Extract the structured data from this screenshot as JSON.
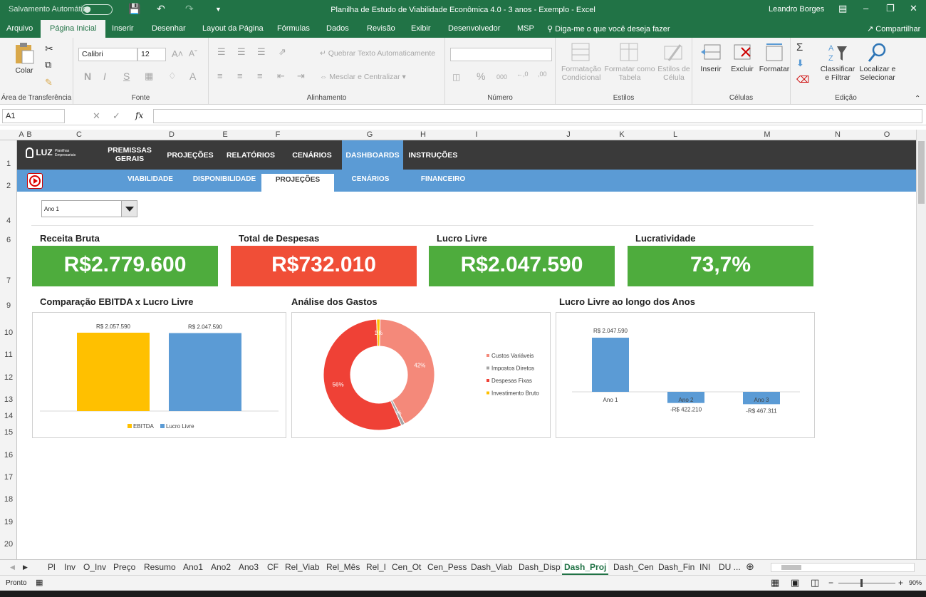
{
  "window": {
    "autosave_label": "Salvamento Automático",
    "title": "Planilha de Estudo de Viabilidade Econômica 4.0 - 3 anos - Exemplo  -  Excel",
    "user": "Leandro Borges"
  },
  "ribbon_tabs": [
    "Arquivo",
    "Página Inicial",
    "Inserir",
    "Desenhar",
    "Layout da Página",
    "Fórmulas",
    "Dados",
    "Revisão",
    "Exibir",
    "Desenvolvedor",
    "MSP"
  ],
  "tell_me": "Diga-me o que você deseja fazer",
  "share": "Compartilhar",
  "ribbon": {
    "paste": "Colar",
    "clipboard": "Área de Transferência",
    "font_name": "Calibri",
    "font_size": "12",
    "font_group": "Fonte",
    "wrap_text": "Quebrar Texto Automaticamente",
    "merge_center": "Mesclar e Centralizar",
    "alignment_group": "Alinhamento",
    "number_group": "Número",
    "cond_format_1": "Formatação",
    "cond_format_2": "Condicional",
    "format_table_1": "Formatar como",
    "format_table_2": "Tabela",
    "cell_styles_1": "Estilos de",
    "cell_styles_2": "Célula",
    "styles_group": "Estilos",
    "insert": "Inserir",
    "delete": "Excluir",
    "format": "Formatar",
    "cells_group": "Células",
    "sort_1": "Classificar",
    "sort_2": "e Filtrar",
    "find_1": "Localizar e",
    "find_2": "Selecionar",
    "editing_group": "Edição"
  },
  "formula_bar": {
    "name_box": "A1",
    "fx": "fx"
  },
  "columns": [
    "A",
    "B",
    "C",
    "D",
    "E",
    "F",
    "G",
    "H",
    "I",
    "J",
    "K",
    "L",
    "M",
    "N",
    "O"
  ],
  "rows": [
    "1",
    "2",
    "4",
    "6",
    "7",
    "9",
    "10",
    "11",
    "12",
    "13",
    "14",
    "15",
    "16",
    "17",
    "18",
    "19",
    "20"
  ],
  "dashboard": {
    "logo": "LUZ",
    "logo_sub": "Planilhas Empresariais",
    "nav": [
      "PREMISSAS GERAIS",
      "PROJEÇÕES",
      "RELATÓRIOS",
      "CENÁRIOS",
      "DASHBOARDS",
      "INSTRUÇÕES"
    ],
    "subnav": [
      "VIABILIDADE",
      "DISPONIBILIDADE",
      "PROJEÇÕES",
      "CENÁRIOS",
      "FINANCEIRO"
    ],
    "year_select": "Ano 1",
    "kpis": [
      {
        "title": "Receita Bruta",
        "value": "R$2.779.600",
        "color": "#4eac3d"
      },
      {
        "title": "Total de Despesas",
        "value": "R$732.010",
        "color": "#f04e37"
      },
      {
        "title": "Lucro Livre",
        "value": "R$2.047.590",
        "color": "#4eac3d"
      },
      {
        "title": "Lucratividade",
        "value": "73,7%",
        "color": "#4eac3d"
      }
    ],
    "charts_titles": [
      "Comparação EBITDA x Lucro Livre",
      "Análise dos Gastos",
      "Lucro Livre ao longo dos Anos"
    ]
  },
  "chart_data": [
    {
      "type": "bar",
      "title": "Comparação EBITDA x Lucro Livre",
      "series": [
        {
          "name": "EBITDA",
          "values": [
            2057590
          ],
          "label": "R$ 2.057.590",
          "color": "#ffc000"
        },
        {
          "name": "Lucro Livre",
          "values": [
            2047590
          ],
          "label": "R$ 2.047.590",
          "color": "#5b9bd5"
        }
      ],
      "legend": "bottom"
    },
    {
      "type": "pie",
      "title": "Análise dos Gastos",
      "donut": true,
      "slices": [
        {
          "name": "Custos Variáveis",
          "value": 42,
          "label": "42%",
          "color": "#f4897a"
        },
        {
          "name": "Impostos Diretos",
          "value": 1,
          "label": "1%",
          "color": "#a5a5a5"
        },
        {
          "name": "Despesas Fixas",
          "value": 56,
          "label": "56%",
          "color": "#ef4136"
        },
        {
          "name": "Investimento Bruto",
          "value": 1,
          "label": "1%",
          "color": "#ffc000"
        }
      ],
      "legend": "right"
    },
    {
      "type": "bar",
      "title": "Lucro Livre ao longo dos Anos",
      "categories": [
        "Ano 1",
        "Ano 2",
        "Ano 3"
      ],
      "values": [
        2047590,
        -422210,
        -467311
      ],
      "labels": [
        "R$ 2.047.590",
        "-R$ 422.210",
        "-R$ 467.311"
      ],
      "color": "#5b9bd5"
    }
  ],
  "sheet_tabs": [
    "Pl",
    "Inv",
    "O_Inv",
    "Preço",
    "Resumo",
    "Ano1",
    "Ano2",
    "Ano3",
    "CF",
    "Rel_Viab",
    "Rel_Mês",
    "Rel_I",
    "Cen_Ot",
    "Cen_Pess",
    "Dash_Viab",
    "Dash_Disp",
    "Dash_Proj",
    "Dash_Cen",
    "Dash_Fin",
    "INI",
    "DU ..."
  ],
  "status": {
    "ready": "Pronto",
    "zoom": "90%"
  }
}
